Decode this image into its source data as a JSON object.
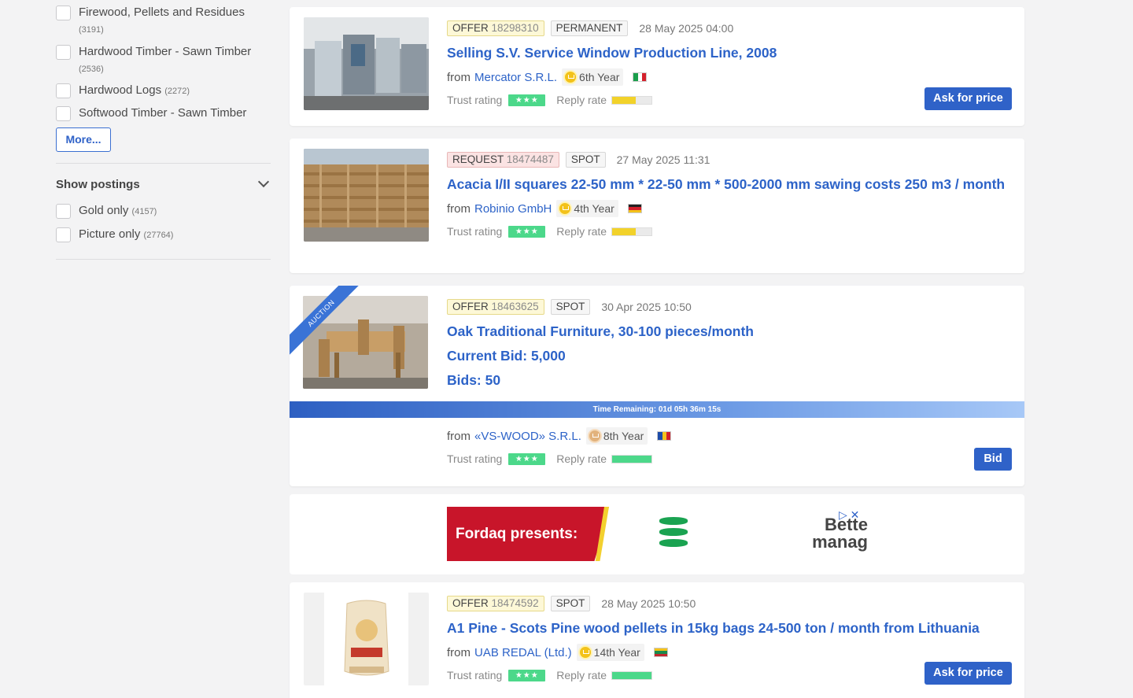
{
  "sidebar": {
    "categories": [
      {
        "label": "Firewood, Pellets and Residues",
        "count": "(3191)"
      },
      {
        "label": "Hardwood Timber - Sawn Timber",
        "count": "(2536)"
      },
      {
        "label": "Hardwood Logs",
        "count": "(2272)"
      },
      {
        "label": "Softwood Timber - Sawn Timber",
        "count": ""
      }
    ],
    "more_label": "More...",
    "show_postings_title": "Show postings",
    "postings": [
      {
        "label": "Gold only",
        "count": "(4157)"
      },
      {
        "label": "Picture only",
        "count": "(27764)"
      }
    ]
  },
  "listings": [
    {
      "type": "OFFER",
      "id": "18298310",
      "tag": "PERMANENT",
      "date": "28 May 2025 04:00",
      "title": "Selling S.V. Service Window Production Line, 2008",
      "from_label": "from",
      "company": "Mercator S.R.L.",
      "year": "6th Year",
      "trust_label": "Trust rating",
      "reply_label": "Reply rate",
      "reply_level": 0.6,
      "button": "Ask for price"
    },
    {
      "type": "REQUEST",
      "id": "18474487",
      "tag": "SPOT",
      "date": "27 May 2025 11:31",
      "title": "Acacia I/II squares 22-50 mm * 22-50 mm * 500-2000 mm sawing costs 250 m3 / month",
      "from_label": "from",
      "company": "Robinio GmbH",
      "year": "4th Year",
      "trust_label": "Trust rating",
      "reply_label": "Reply rate",
      "reply_level": 0.6
    },
    {
      "type": "OFFER",
      "id": "18463625",
      "tag": "SPOT",
      "date": "30 Apr 2025 10:50",
      "title": "Oak Traditional Furniture, 30-100 pieces/month",
      "bid": "Current Bid: 5,000",
      "bids": "Bids: 50",
      "ribbon": "AUCTION",
      "time_remaining": "Time Remaining: 01d 05h 36m 15s",
      "from_label": "from",
      "company": "«VS-WOOD» S.R.L.",
      "year": "8th Year",
      "trust_label": "Trust rating",
      "reply_label": "Reply rate",
      "reply_level": 1.0,
      "button": "Bid"
    },
    {
      "type": "OFFER",
      "id": "18474592",
      "tag": "SPOT",
      "date": "28 May 2025 10:50",
      "title": "A1 Pine - Scots Pine wood pellets in 15kg bags 24-500 ton / month from Lithuania",
      "from_label": "from",
      "company": "UAB REDAL (Ltd.)",
      "year": "14th Year",
      "trust_label": "Trust rating",
      "reply_label": "Reply rate",
      "reply_level": 1.0,
      "button": "Ask for price"
    }
  ],
  "ad": {
    "banner_text": "Fordaq presents:",
    "side_text_1": "Bette",
    "side_text_2": "manag"
  },
  "colors": {
    "accent": "#2f62c8",
    "stars": "#4cd88a",
    "reply_yellow": "#f2d22a",
    "reply_green": "#4cd88a"
  }
}
